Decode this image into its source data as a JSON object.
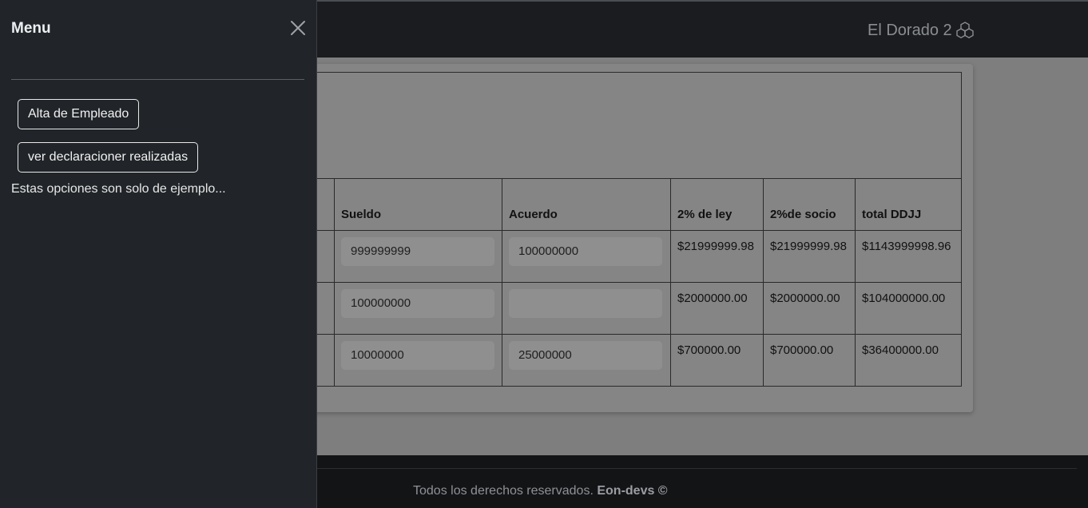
{
  "navbar": {
    "brand": "El Dorado 2",
    "brand_icon": "boxes-icon"
  },
  "menu": {
    "title": "Menu",
    "buttons": [
      "Alta de Empleado",
      "ver declaracioner realizadas"
    ],
    "note": "Estas opciones son solo de ejemplo..."
  },
  "table": {
    "headers": [
      "Sueldo",
      "Acuerdo",
      "2% de ley",
      "2%de socio",
      "total DDJJ"
    ],
    "rows": [
      {
        "sueldo": "999999999",
        "acuerdo": "100000000",
        "ley": "$21999999.98",
        "socio": "$21999999.98",
        "total": "$1143999998.96"
      },
      {
        "sueldo": "100000000",
        "acuerdo": "",
        "ley": "$2000000.00",
        "socio": "$2000000.00",
        "total": "$104000000.00"
      },
      {
        "sueldo": "10000000",
        "acuerdo": "25000000",
        "ley": "$700000.00",
        "socio": "$700000.00",
        "total": "$36400000.00"
      }
    ]
  },
  "footer": {
    "text": "Todos los derechos reservados. ",
    "brand": "Eon-devs ©"
  },
  "colors": {
    "offcanvas_bg": "#212529",
    "navbar_bg": "#1a1c1f",
    "backdrop": "#7e7e7e"
  }
}
